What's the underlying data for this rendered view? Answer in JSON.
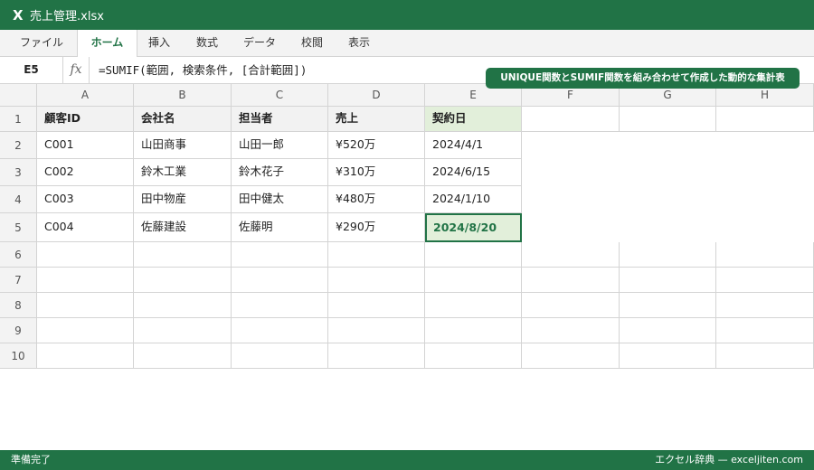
{
  "window": {
    "app_icon": "excel-x-icon",
    "app_letter": "X",
    "title": "売上管理.xlsx"
  },
  "ribbon": {
    "tabs": [
      {
        "label": "ファイル",
        "active": false
      },
      {
        "label": "ホーム",
        "active": true
      },
      {
        "label": "挿入",
        "active": false
      },
      {
        "label": "数式",
        "active": false
      },
      {
        "label": "データ",
        "active": false
      },
      {
        "label": "校閲",
        "active": false
      },
      {
        "label": "表示",
        "active": false
      }
    ]
  },
  "formula_bar": {
    "name_box": "E5",
    "fx_label": "fx",
    "formula": "=SUMIF(範囲, 検索条件, [合計範囲])"
  },
  "callout": "UNIQUE関数とSUMIF関数を組み合わせて作成した動的な集計表",
  "sheet": {
    "columns": [
      "A",
      "B",
      "C",
      "D",
      "E",
      "F",
      "G",
      "H"
    ],
    "rows": [
      "1",
      "2",
      "3",
      "4",
      "5",
      "6",
      "7",
      "8",
      "9",
      "10"
    ],
    "header_row": [
      "顧客ID",
      "会社名",
      "担当者",
      "売上",
      "契約日"
    ],
    "data_rows": [
      [
        "C001",
        "山田商事",
        "山田一郎",
        "¥520万",
        "2024/4/1"
      ],
      [
        "C002",
        "鈴木工業",
        "鈴木花子",
        "¥310万",
        "2024/6/15"
      ],
      [
        "C003",
        "田中物産",
        "田中健太",
        "¥480万",
        "2024/1/10"
      ],
      [
        "C004",
        "佐藤建設",
        "佐藤明",
        "¥290万",
        "2024/8/20"
      ]
    ],
    "selected_cell": "E5"
  },
  "status_bar": {
    "left": "準備完了",
    "right": "エクセル辞典 — exceljiten.com"
  },
  "colors": {
    "accent": "#217346",
    "selected_fill": "#e2efda",
    "header_fill": "#f2f2f2",
    "grid_line": "#d4d4d4"
  }
}
